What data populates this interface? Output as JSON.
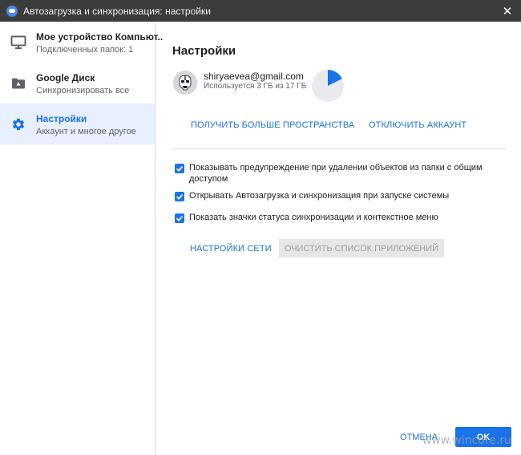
{
  "window": {
    "title": "Автозагрузка и синхронизация: настройки",
    "close_glyph": "✕"
  },
  "sidebar": {
    "items": [
      {
        "title": "Мое устройство Компьют..",
        "subtitle": "Подключенных папок: 1",
        "icon": "monitor-icon",
        "active": false
      },
      {
        "title": "Google Диск",
        "subtitle": "Синхронизировать все",
        "icon": "drive-folder-icon",
        "active": false
      },
      {
        "title": "Настройки",
        "subtitle": "Аккаунт и многое другое",
        "icon": "gear-icon",
        "active": true
      }
    ]
  },
  "main": {
    "title": "Настройки",
    "account": {
      "email": "shiryaevea@gmail.com",
      "usage": "Используется 3 ГБ из 17 ГБ",
      "used_fraction": 0.176
    },
    "get_more_space_label": "ПОЛУЧИТЬ БОЛЬШЕ ПРОСТРАНСТВА",
    "disconnect_label": "ОТКЛЮЧИТЬ АККАУНТ",
    "options": [
      {
        "label": "Показывать предупреждение при удалении объектов из папки с общим доступом",
        "checked": true
      },
      {
        "label": "Открывать Автозагрузка и синхронизация при запуске системы",
        "checked": true
      },
      {
        "label": "Показать значки статуса синхронизации и контекстное меню",
        "checked": true
      }
    ],
    "network_settings_label": "НАСТРОЙКИ СЕТИ",
    "clear_apps_label": "ОЧИСТИТЬ СПИСОК ПРИЛОЖЕНИЙ"
  },
  "footer": {
    "cancel_label": "ОТМЕНА",
    "ok_label": "OK"
  },
  "watermark": "www.wincore.ru",
  "colors": {
    "accent": "#1a73e8",
    "titlebar": "#3c3c3c",
    "active_bg": "#e8f0fe",
    "pie_empty": "#e8eaed"
  }
}
